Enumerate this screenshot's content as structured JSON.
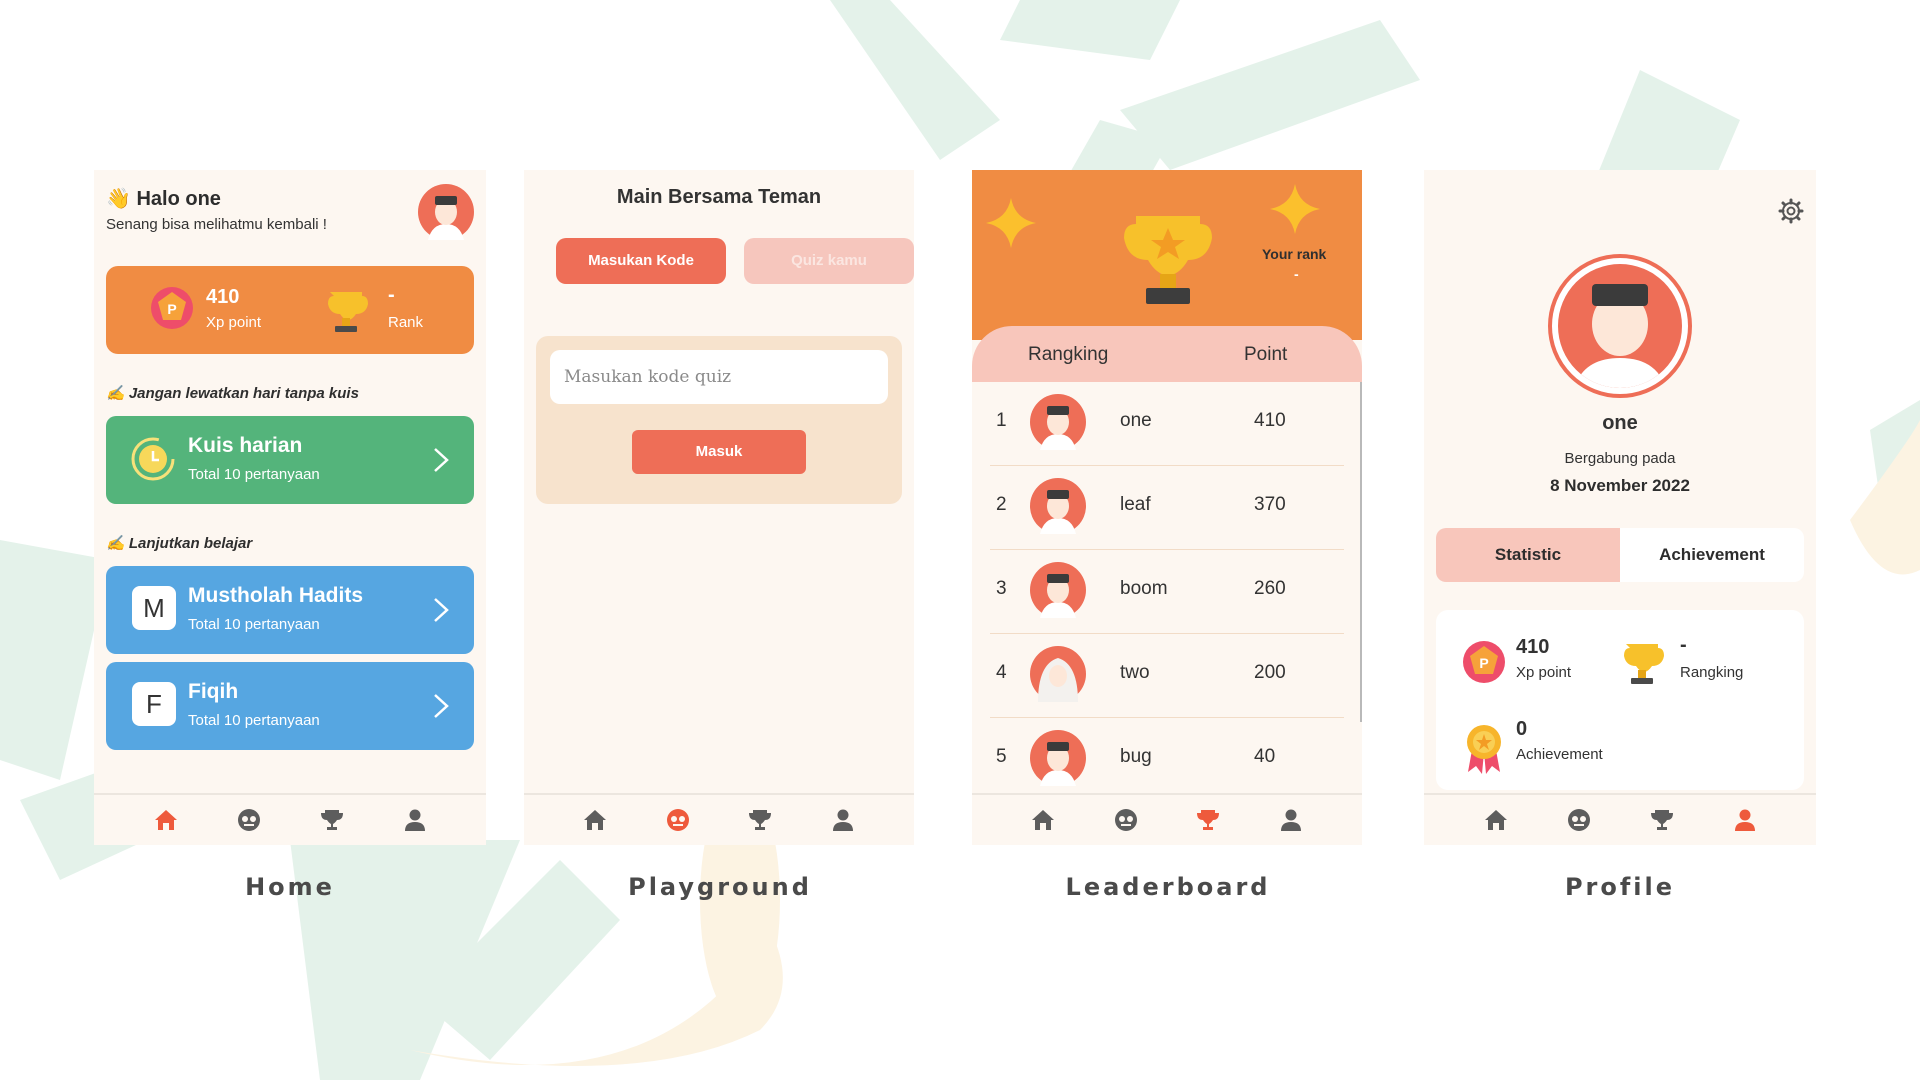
{
  "home": {
    "greeting": "👋 Halo one",
    "subgreeting": "Senang bisa melihatmu kembali !",
    "xp_value": "410",
    "xp_label": "Xp point",
    "rank_value": "-",
    "rank_label": "Rank",
    "section_daily": "✍️ Jangan lewatkan hari tanpa kuis",
    "daily_title": "Kuis harian",
    "daily_sub": "Total 10 pertanyaan",
    "section_continue": "✍️ Lanjutkan belajar",
    "courses": [
      {
        "letter": "M",
        "title": "Mustholah Hadits",
        "sub": "Total 10 pertanyaan"
      },
      {
        "letter": "F",
        "title": "Fiqih",
        "sub": "Total 10 pertanyaan"
      }
    ],
    "caption": "Home"
  },
  "playground": {
    "title": "Main Bersama Teman",
    "tab_code": "Masukan Kode",
    "tab_quiz": "Quiz kamu",
    "input_placeholder": "Masukan kode quiz",
    "submit": "Masuk",
    "caption": "Playground"
  },
  "leaderboard": {
    "your_rank_label": "Your rank",
    "your_rank_value": "-",
    "col_rank": "Rangking",
    "col_point": "Point",
    "rows": [
      {
        "rank": "1",
        "name": "one",
        "points": "410"
      },
      {
        "rank": "2",
        "name": "leaf",
        "points": "370"
      },
      {
        "rank": "3",
        "name": "boom",
        "points": "260"
      },
      {
        "rank": "4",
        "name": "two",
        "points": "200"
      },
      {
        "rank": "5",
        "name": "bug",
        "points": "40"
      }
    ],
    "caption": "Leaderboard"
  },
  "profile": {
    "name": "one",
    "joined_label": "Bergabung pada",
    "joined_date": "8 November 2022",
    "tab_statistic": "Statistic",
    "tab_achievement": "Achievement",
    "xp_value": "410",
    "xp_label": "Xp point",
    "rank_value": "-",
    "rank_label": "Rangking",
    "ach_value": "0",
    "ach_label": "Achievement",
    "caption": "Profile"
  },
  "colors": {
    "orange": "#f08c43",
    "coral": "#ee6e57",
    "green": "#54b47b",
    "blue": "#56a6e1",
    "pink": "#f8c6bb",
    "cream": "#fdf7f1",
    "nav_active": "#ee5a3c",
    "nav_inactive": "#5d5d5d"
  },
  "nav_icons": [
    "home-icon",
    "playground-icon",
    "trophy-icon",
    "profile-icon"
  ]
}
